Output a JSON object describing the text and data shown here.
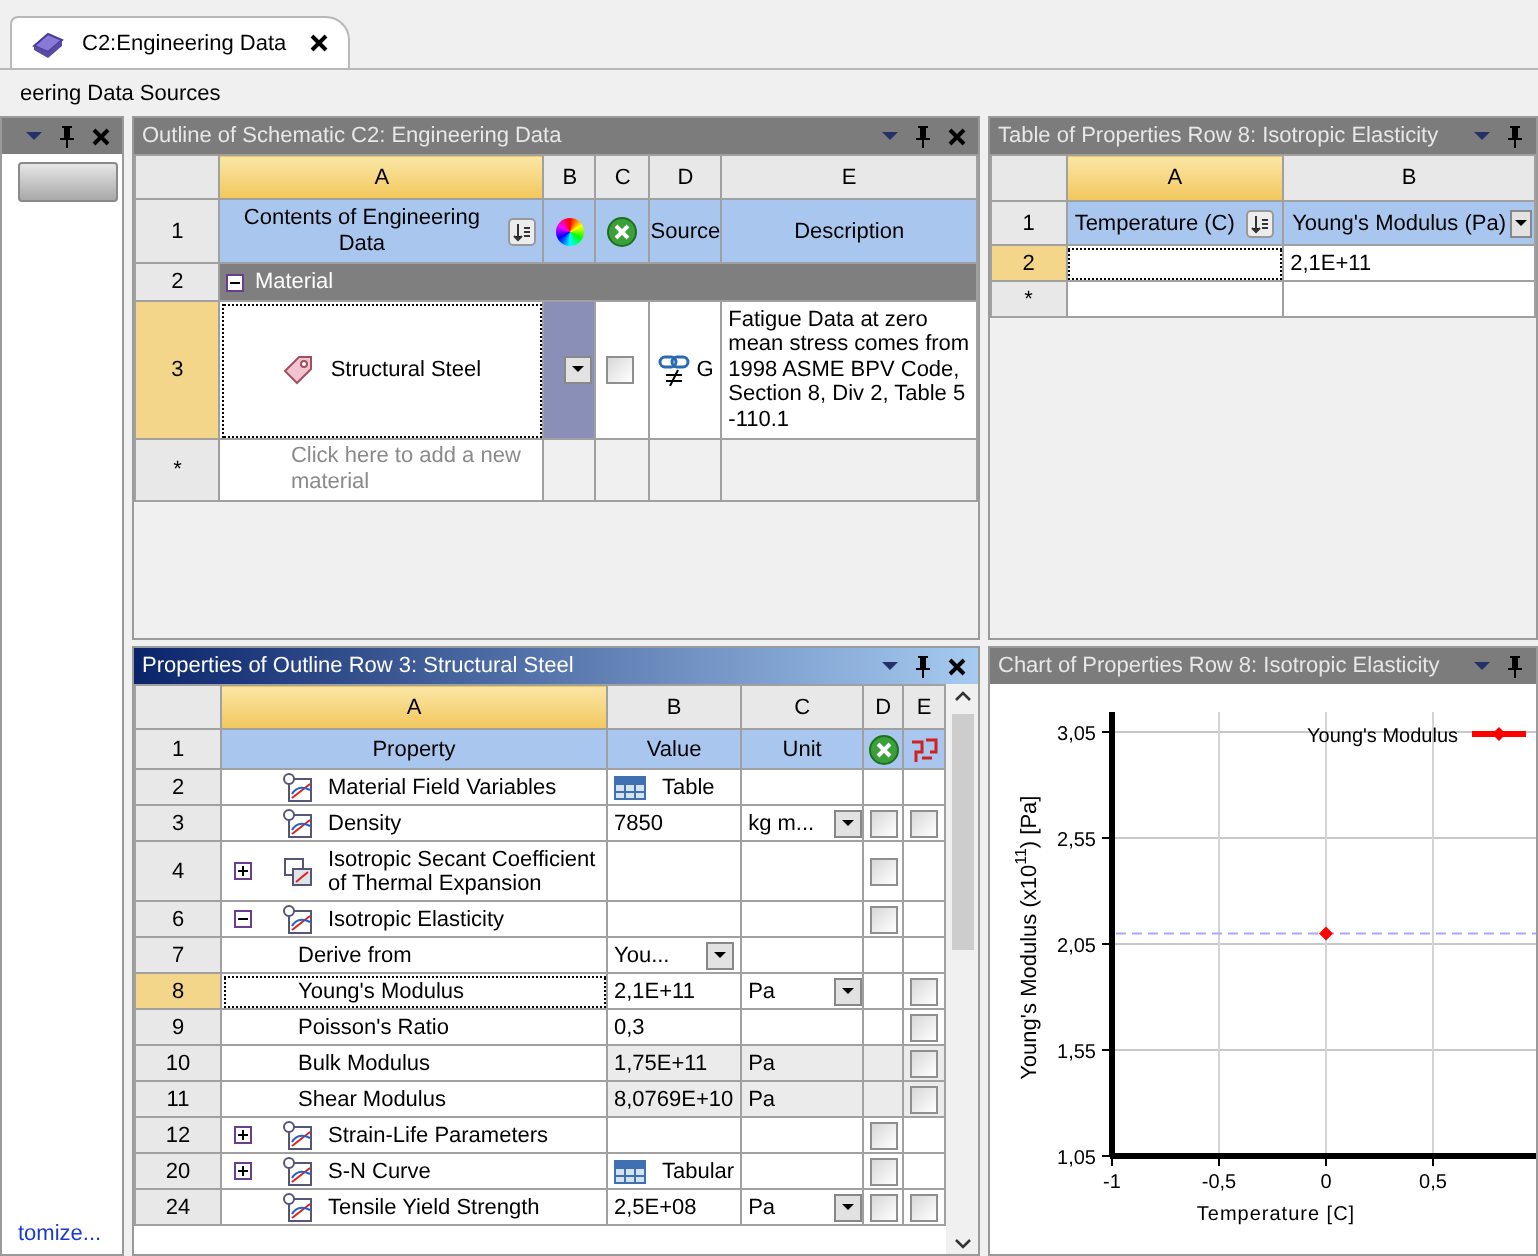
{
  "tab": {
    "title": "C2:Engineering Data",
    "selected": true
  },
  "toolbar": {
    "title": "eering Data Sources"
  },
  "toolbox": {
    "active": false,
    "link": "tomize..."
  },
  "outline": {
    "title": "Outline of Schematic C2: Engineering Data",
    "active": false,
    "columns": [
      "A",
      "B",
      "C",
      "D",
      "E"
    ],
    "header": {
      "row": "1",
      "contents": "Contents of Engineering Data",
      "source": "Source",
      "description": "Description"
    },
    "category": {
      "row": "2",
      "label": "Material",
      "expanded": true
    },
    "rows": [
      {
        "row": "3",
        "name": "Structural Steel",
        "selected": true,
        "color": "#8a8fb8",
        "suppressed": false,
        "source": "G",
        "description": "Fatigue Data at zero mean stress comes from 1998 ASME BPV Code, Section 8, Div 2, Table 5 -110.1"
      }
    ],
    "add_row": {
      "row": "*",
      "placeholder": "Click here to add a new material"
    }
  },
  "properties": {
    "title": "Properties of Outline Row 3: Structural Steel",
    "active": true,
    "columns": [
      "A",
      "B",
      "C",
      "D",
      "E"
    ],
    "header": {
      "row": "1",
      "property": "Property",
      "value": "Value",
      "unit": "Unit"
    },
    "rows": [
      {
        "row": "2",
        "kind": "property",
        "name": "Material Field Variables",
        "value": {
          "kind": "table",
          "text": "Table"
        },
        "selected": false,
        "readonly": false
      },
      {
        "row": "3",
        "kind": "property",
        "name": "Density",
        "value": {
          "kind": "text",
          "text": "7850"
        },
        "unit": "kg m...",
        "unit_dropdown": true,
        "suppressed": false,
        "parameterized": false,
        "selected": false,
        "readonly": false
      },
      {
        "row": "4",
        "kind": "composite",
        "expanded": false,
        "name": "Isotropic Secant Coefficient of Thermal Expansion",
        "suppressed": false,
        "selected": false,
        "readonly": false
      },
      {
        "row": "6",
        "kind": "property",
        "expanded": true,
        "name": "Isotropic Elasticity",
        "suppressed": false,
        "selected": false,
        "readonly": false
      },
      {
        "row": "7",
        "kind": "sub",
        "name": "Derive from",
        "value": {
          "kind": "dropdown",
          "text": "You..."
        },
        "selected": false,
        "readonly": false
      },
      {
        "row": "8",
        "kind": "sub",
        "name": "Young's Modulus",
        "value": {
          "kind": "text",
          "text": "2,1E+11"
        },
        "unit": "Pa",
        "unit_dropdown": true,
        "parameterized": false,
        "selected": true,
        "readonly": false
      },
      {
        "row": "9",
        "kind": "sub",
        "name": "Poisson's Ratio",
        "value": {
          "kind": "text",
          "text": "0,3"
        },
        "parameterized": false,
        "selected": false,
        "readonly": false
      },
      {
        "row": "10",
        "kind": "sub",
        "name": "Bulk Modulus",
        "value": {
          "kind": "text",
          "text": "1,75E+11"
        },
        "unit": "Pa",
        "unit_dropdown": false,
        "parameterized": false,
        "selected": false,
        "readonly": true
      },
      {
        "row": "11",
        "kind": "sub",
        "name": "Shear Modulus",
        "value": {
          "kind": "text",
          "text": "8,0769E+10"
        },
        "unit": "Pa",
        "unit_dropdown": false,
        "parameterized": false,
        "selected": false,
        "readonly": true
      },
      {
        "row": "12",
        "kind": "property",
        "expanded": false,
        "name": "Strain-Life Parameters",
        "suppressed": false,
        "selected": false,
        "readonly": false
      },
      {
        "row": "20",
        "kind": "property",
        "expanded": false,
        "name": "S-N Curve",
        "value": {
          "kind": "table",
          "text": "Tabular"
        },
        "suppressed": false,
        "selected": false,
        "readonly": false
      },
      {
        "row": "24",
        "kind": "property",
        "name": "Tensile Yield Strength",
        "value": {
          "kind": "text",
          "text": "2,5E+08"
        },
        "unit": "Pa",
        "unit_dropdown": true,
        "suppressed": false,
        "parameterized": false,
        "selected": false,
        "readonly": false
      }
    ]
  },
  "table": {
    "title": "Table of Properties Row 8: Isotropic Elasticity",
    "active": false,
    "columns": [
      "A",
      "B"
    ],
    "header": {
      "row": "1",
      "temperature": "Temperature (C)",
      "modulus": "Young's Modulus (Pa)"
    },
    "rows": [
      {
        "row": "2",
        "modulus": "2,1E+11",
        "selected": true
      }
    ],
    "add_row": {
      "row": "*"
    }
  },
  "chart": {
    "title": "Chart of Properties Row 8: Isotropic Elasticity",
    "active": false,
    "chart_data": {
      "type": "line",
      "xlabel": "Temperature  [C]",
      "ylabel": "Young's Modulus  (x10$^{11}$)  [Pa]",
      "x": [
        0
      ],
      "series": [
        {
          "name": "Young's Modulus",
          "color": "#ff0000",
          "marker": "diamond",
          "values": [
            2.1
          ]
        }
      ],
      "grid": true,
      "ref_lines": [
        {
          "axis": "y",
          "value": 2.1,
          "color": "#a8a8ff"
        }
      ],
      "xlim": [
        -1,
        1
      ],
      "ylim": [
        1.05,
        3.05
      ],
      "xticks": [
        {
          "value": -1,
          "label": "-1"
        },
        {
          "value": -0.5,
          "label": "-0,5"
        },
        {
          "value": 0,
          "label": "0"
        },
        {
          "value": 0.5,
          "label": "0,5"
        }
      ],
      "yticks": [
        {
          "value": 1.05,
          "label": "1,05"
        },
        {
          "value": 1.55,
          "label": "1,55"
        },
        {
          "value": 2.05,
          "label": "2,05"
        },
        {
          "value": 2.55,
          "label": "2,55"
        },
        {
          "value": 3.05,
          "label": "3,05"
        }
      ]
    }
  }
}
